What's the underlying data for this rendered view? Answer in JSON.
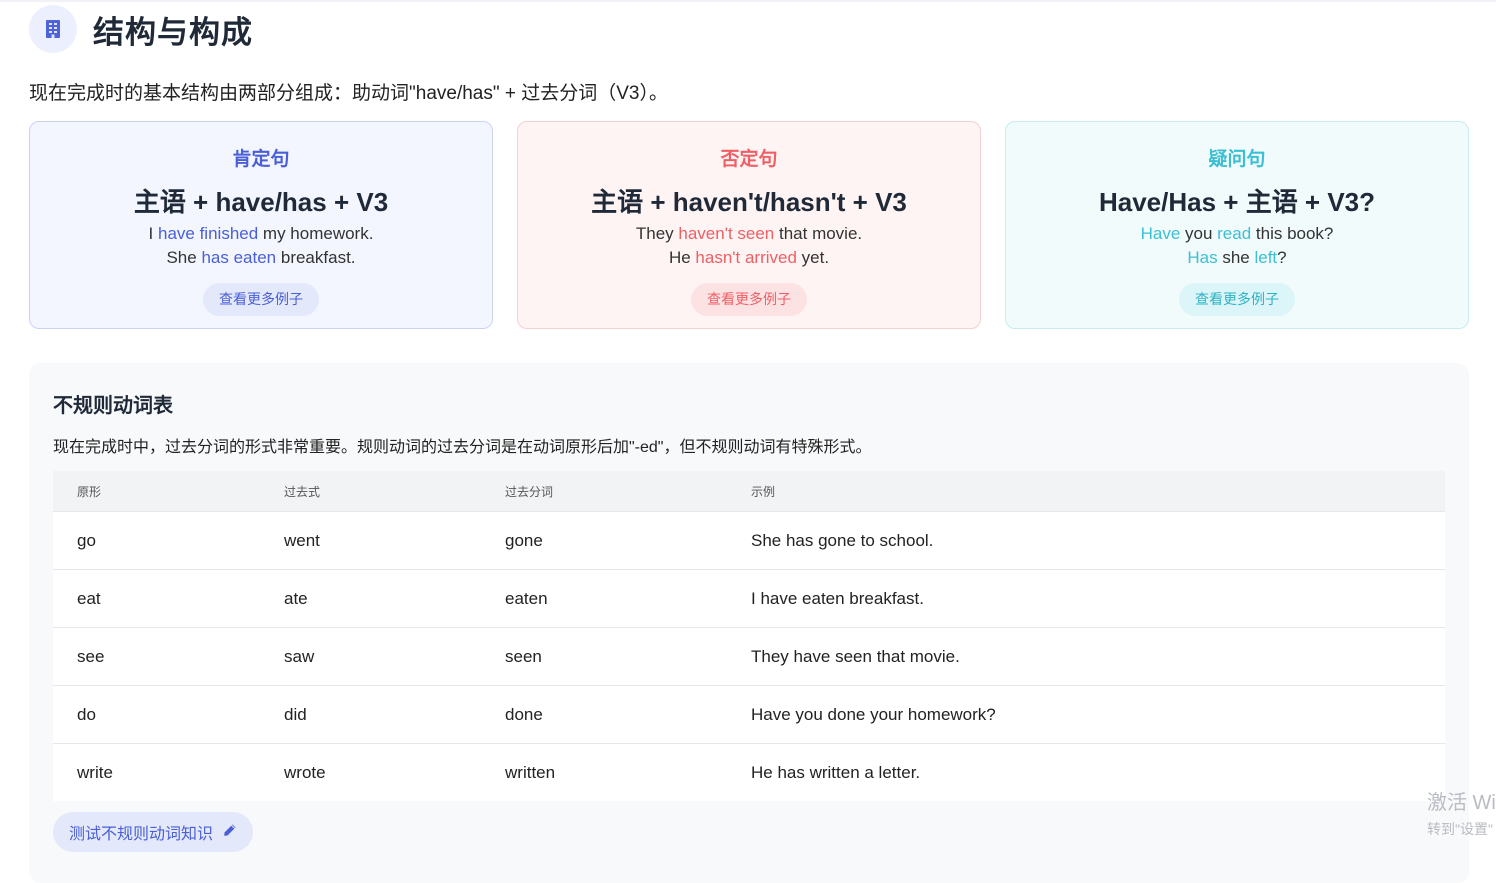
{
  "header": {
    "icon": "building-icon",
    "title": "结构与构成"
  },
  "intro": "现在完成时的基本结构由两部分组成：助动词\"have/has\" + 过去分词（V3）。",
  "cards": [
    {
      "title": "肯定句",
      "formula": "主语 + have/has + V3",
      "ex1": {
        "pre": "I ",
        "hl": "have finished",
        "post": " my homework."
      },
      "ex2": {
        "pre": "She ",
        "hl": "has eaten",
        "post": " breakfast."
      },
      "button": "查看更多例子",
      "accent": "#4a5fd6"
    },
    {
      "title": "否定句",
      "formula": "主语 + haven't/hasn't + V3",
      "ex1": {
        "pre": "They ",
        "hl": "haven't seen",
        "post": " that movie."
      },
      "ex2": {
        "pre": "He ",
        "hl": "hasn't arrived",
        "post": " yet."
      },
      "button": "查看更多例子",
      "accent": "#ee6065"
    },
    {
      "title": "疑问句",
      "formula": "Have/Has + 主语 + V3?",
      "ex1": {
        "hl1": "Have",
        "mid": " you ",
        "hl2": "read",
        "post": " this book?"
      },
      "ex2": {
        "hl1": "Has",
        "mid": " she ",
        "hl2": "left",
        "post": "?"
      },
      "button": "查看更多例子",
      "accent": "#3dbfd3"
    }
  ],
  "irregular": {
    "title": "不规则动词表",
    "desc": "现在完成时中，过去分词的形式非常重要。规则动词的过去分词是在动词原形后加\"-ed\"，但不规则动词有特殊形式。",
    "headers": [
      "原形",
      "过去式",
      "过去分词",
      "示例"
    ],
    "rows": [
      [
        "go",
        "went",
        "gone",
        "She has gone to school."
      ],
      [
        "eat",
        "ate",
        "eaten",
        "I have eaten breakfast."
      ],
      [
        "see",
        "saw",
        "seen",
        "They have seen that movie."
      ],
      [
        "do",
        "did",
        "done",
        "Have you done your homework?"
      ],
      [
        "write",
        "wrote",
        "written",
        "He has written a letter."
      ]
    ],
    "quiz_button": "测试不规则动词知识",
    "quiz_icon": "pencil-icon"
  },
  "watermark": {
    "line1": "激活 Wi",
    "line2": "转到\"设置\""
  }
}
